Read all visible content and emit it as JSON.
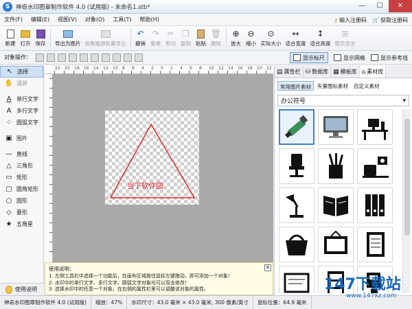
{
  "window": {
    "title": "神奇水印图章制作软件 4.0 (试用版) - 未命名1.stb*",
    "controls": [
      "—",
      "☐",
      "✕"
    ]
  },
  "menu": {
    "items": [
      "文件(F)",
      "编辑(E)",
      "视图(V)",
      "对象(O)",
      "工具(T)",
      "帮助(H)"
    ],
    "register": "输入注册码",
    "buy": "获取注册码"
  },
  "toolbar": {
    "new": "新建",
    "open": "打开",
    "save": "保存",
    "export_image": "导出为图片",
    "batch_export": "依数据源批量导出",
    "undo": "撤销",
    "redo": "重做",
    "cut": "剪切",
    "copy": "复制",
    "paste": "粘贴",
    "delete": "删除",
    "zoom_in": "放大",
    "zoom_out": "缩小",
    "actual_size": "实际大小",
    "fit_width": "适合宽度",
    "fit_height": "适合高度",
    "fit_page": "整页显示"
  },
  "object_bar": {
    "label": "对象操作：",
    "show_ruler": "显示标尺",
    "show_grid": "显示网格",
    "show_guides": "显示参考线"
  },
  "tools": [
    {
      "label": "选择",
      "icon": "arrow-cursor-icon",
      "glyph": "↖",
      "active": true
    },
    {
      "label": "漫屏",
      "icon": "hand-icon",
      "glyph": "✋",
      "disabled": true
    },
    {
      "label": "单行文字",
      "icon": "text-single-icon",
      "glyph": "A"
    },
    {
      "label": "多行文字",
      "icon": "text-multi-icon",
      "glyph": "A"
    },
    {
      "label": "圆弧文字",
      "icon": "arc-text-icon",
      "glyph": "⁘"
    },
    {
      "label": "图片",
      "icon": "picture-icon",
      "glyph": "▣"
    },
    {
      "label": "直线",
      "icon": "line-icon",
      "glyph": "—"
    },
    {
      "label": "三角形",
      "icon": "triangle-icon",
      "glyph": "△"
    },
    {
      "label": "矩形",
      "icon": "rectangle-icon",
      "glyph": "▭"
    },
    {
      "label": "圆角矩形",
      "icon": "rounded-rect-icon",
      "glyph": "▢"
    },
    {
      "label": "圆形",
      "icon": "circle-icon",
      "glyph": "○"
    },
    {
      "label": "菱形",
      "icon": "diamond-icon",
      "glyph": "◇"
    },
    {
      "label": "五角星",
      "icon": "star-icon",
      "glyph": "★"
    }
  ],
  "help_button": "使用说明",
  "canvas": {
    "ruler_numbers": [
      "22",
      "20",
      "18",
      "16",
      "14",
      "12",
      "10",
      "8",
      "6",
      "4",
      "2",
      "0",
      "2",
      "4",
      "6",
      "8",
      "10",
      "12",
      "14",
      "16",
      "18",
      "20",
      "22"
    ],
    "watermark_text": "当下软件园",
    "shape_color": "#e02a2a"
  },
  "info": {
    "title": "使用说明：",
    "lines": [
      "1. 左侧工具栏中选择一个功能后，在画布区域按住鼠标左键拖动，即可添加一个对象！",
      "2. 水印中的单行文字、多行文字、圆弧文字对象均可以双击修改！",
      "3. 选择水印中的任意一个对象，在右侧的属性栏里可以调整该对象的属性。"
    ],
    "close": "✕"
  },
  "right_panel": {
    "tabs": [
      "属性栏",
      "数据库",
      "模板库",
      "素材库"
    ],
    "subtabs": [
      "常用图片素材",
      "矢量图标素材",
      "自定义素材"
    ],
    "category": "办公符号",
    "category_arrow": "▾",
    "items": [
      "marker-pen-icon",
      "monitor-icon",
      "desk-computer-icon",
      "office-chair-icon",
      "pen-holder-icon",
      "telephone-email-icon",
      "desk-lamp-icon",
      "open-book-icon",
      "binder-folders-icon",
      "shopping-basket-icon",
      "notice-board-icon",
      "notebook-icon",
      "whiteboard-icon",
      "filing-cabinet-icon",
      "coffee-machine-icon"
    ]
  },
  "status": {
    "app": "神奇水印图章制作软件 4.0 (试用版)",
    "zoom": "缩放：47%",
    "size": "水印尺寸：43.0 毫米 × 43.0 毫米, 300 像素/英寸",
    "mouse": "鼠标位置：64.9 毫米"
  },
  "logo": {
    "main": "147下载站",
    "url": "www.147xz.com"
  }
}
